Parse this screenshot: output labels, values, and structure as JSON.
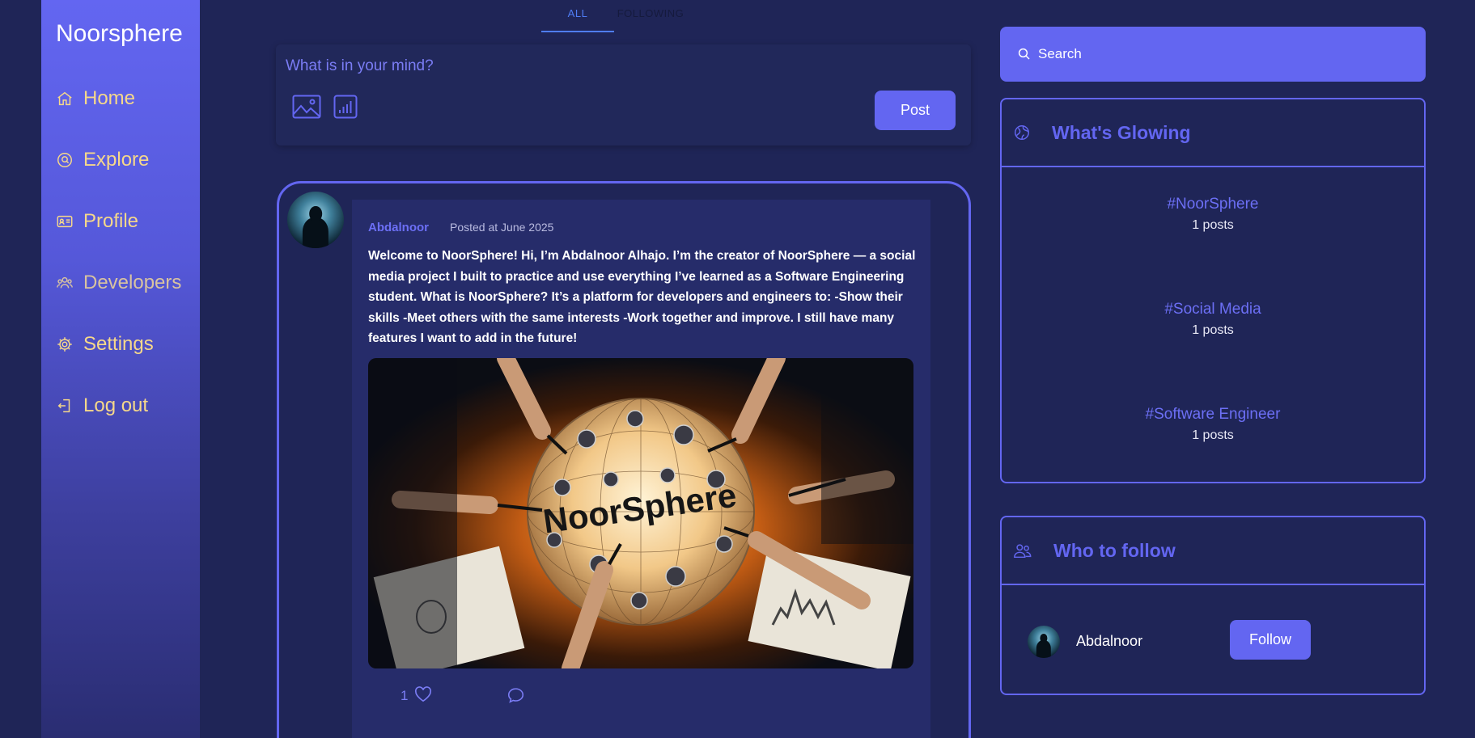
{
  "app": {
    "brand": "Noorsphere"
  },
  "sidebar": {
    "items": [
      {
        "label": "Home",
        "icon": "home-icon"
      },
      {
        "label": "Explore",
        "icon": "explore-icon"
      },
      {
        "label": "Profile",
        "icon": "profile-card-icon"
      },
      {
        "label": "Developers",
        "icon": "users-icon"
      },
      {
        "label": "Settings",
        "icon": "gear-icon"
      },
      {
        "label": "Log out",
        "icon": "logout-icon"
      }
    ]
  },
  "feed_tabs": [
    {
      "label": "ALL",
      "active": true
    },
    {
      "label": "FOLLOWING",
      "active": false
    }
  ],
  "composer": {
    "placeholder": "What is in your mind?",
    "post_label": "Post",
    "tools": [
      "image-icon",
      "poll-icon"
    ]
  },
  "post": {
    "author": "Abdalnoor",
    "date": "Posted at June 2025",
    "text": "Welcome to NoorSphere! Hi, I’m Abdalnoor Alhajo. I’m the creator of NoorSphere — a social media project I built to practice and use everything I’ve learned as a Software Engineering student. What is NoorSphere? It’s a platform for developers and engineers to: -Show their skills -Meet others with the same interests -Work together and improve. I still have many features I want to add in the future!",
    "image_text": "NoorSphere",
    "likes": "1"
  },
  "search": {
    "placeholder": "Search"
  },
  "trending": {
    "title": "What's Glowing",
    "items": [
      {
        "tag": "#NoorSphere",
        "count": "1 posts"
      },
      {
        "tag": "#Social Media",
        "count": "1 posts"
      },
      {
        "tag": "#Software Engineer",
        "count": "1 posts"
      }
    ]
  },
  "who_to_follow": {
    "title": "Who to follow",
    "users": [
      {
        "name": "Abdalnoor",
        "button": "Follow"
      }
    ]
  },
  "colors": {
    "background": "#1f2557",
    "accent": "#6366f1",
    "nav_text": "#f6d88a",
    "tab_active": "#4f7df5"
  }
}
